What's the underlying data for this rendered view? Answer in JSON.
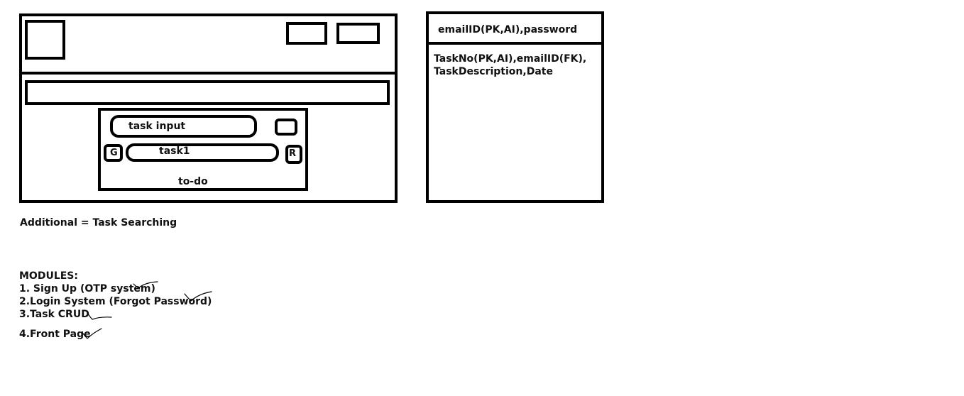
{
  "mockup": {
    "task_input_label": "task input",
    "g_button_label": "G",
    "task_item_label": "task1",
    "r_button_label": "R",
    "todo_label": "to-do"
  },
  "database": {
    "users_schema": "emailID(PK,AI),password",
    "tasks_schema_line1": "TaskNo(PK,AI),emailID(FK),",
    "tasks_schema_line2": "TaskDescription,Date"
  },
  "notes": {
    "additional": "Additional = Task Searching",
    "modules_title": "MODULES:",
    "modules": [
      "1. Sign Up (OTP system)",
      "2.Login System (Forgot Password)",
      "3.Task CRUD",
      "4.Front Page"
    ]
  }
}
